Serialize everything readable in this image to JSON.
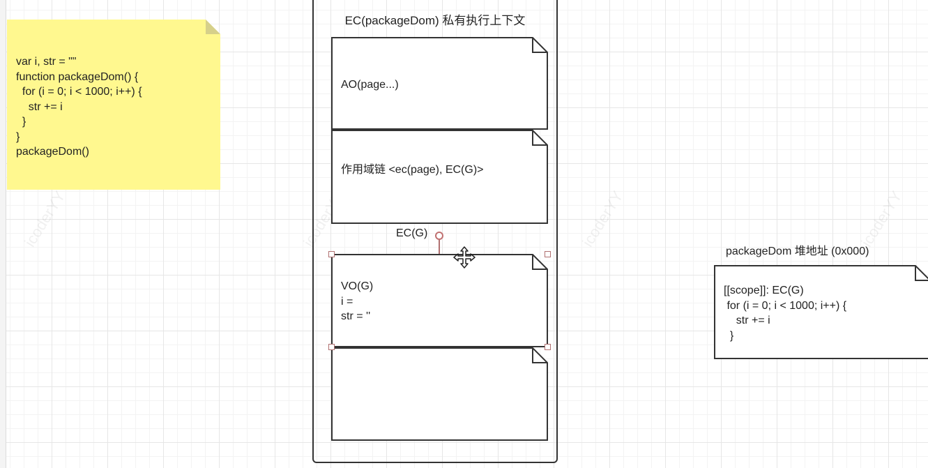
{
  "canvas": {
    "watermark": "icoderYY"
  },
  "sticky_note": {
    "code": "var i, str = \"\"\nfunction packageDom() {\n  for (i = 0; i < 1000; i++) {\n    str += i\n  }\n}\npackageDom()"
  },
  "execution_context": {
    "title": "EC(packageDom) 私有执行上下文",
    "ao_note": "AO(page...)",
    "scope_chain_note": "作用域链 <ec(page), EC(G)>",
    "global_label": "EC(G)",
    "vo_note": "VO(G)\ni = \nstr = ''",
    "empty_note": ""
  },
  "heap": {
    "label": "packageDom 堆地址 (0x000)",
    "content": "[[scope]]: EC(G)\n for (i = 0; i < 1000; i++) {\n    str += i\n  }"
  },
  "colors": {
    "sticky": "#fff88f",
    "stroke": "#333333",
    "selection": "#b07070"
  },
  "icons": {
    "move_cursor": "move-cursor-icon",
    "rotate_handle": "rotate-handle-icon"
  }
}
